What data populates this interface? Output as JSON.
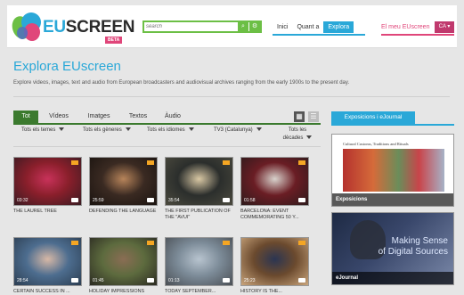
{
  "header": {
    "logo_text_a": "EU",
    "logo_text_b": "SCREEN",
    "logo_badge": "BETA",
    "search_placeholder": "search",
    "nav": [
      "Inici",
      "Quant a",
      "Explora"
    ],
    "my_label": "El meu EUscreen",
    "lang": "CA ▾"
  },
  "page": {
    "title": "Explora EUscreen",
    "intro": "Explore videos, images, text and audio from European broadcasters and audiovisual archives ranging from the early 1900s to the present day."
  },
  "tabs": [
    "Tot",
    "Vídeos",
    "Imatges",
    "Textos",
    "Àudio"
  ],
  "filters": [
    "Tots els temes",
    "Tots els gèneres",
    "Tots els idiomes",
    "TV3 (Catalunya)",
    "Tots les dècades"
  ],
  "items": [
    {
      "duration": "03:32",
      "title": "THE LAUREL TREE",
      "colors": [
        "#8a1f2b",
        "#c8325a",
        "#3a1b22"
      ]
    },
    {
      "duration": "25:59",
      "title": "DEFENDING THE LANGUAGE",
      "colors": [
        "#3a2a22",
        "#b7845a",
        "#1b1410"
      ]
    },
    {
      "duration": "35:54",
      "title": "THE FIRST PUBLICATION OF THE \"AVUI\"",
      "colors": [
        "#2b2e2c",
        "#d9c8a4",
        "#4b4a3e"
      ]
    },
    {
      "duration": "01:58",
      "title": "BARCELONA: EVENT COMMEMORATING 50 Y...",
      "colors": [
        "#6a1d24",
        "#d8d2cc",
        "#2e1b1c"
      ]
    },
    {
      "duration": "28:54",
      "title": "CERTAIN SUCCESS IN ...",
      "colors": [
        "#4d6d8f",
        "#d7b8a6",
        "#2c3e52"
      ]
    },
    {
      "duration": "01:45",
      "title": "HOLIDAY IMPRESSIONS",
      "colors": [
        "#5d6b3e",
        "#8a6d54",
        "#2b2a22"
      ]
    },
    {
      "duration": "01:13",
      "title": "TODAY SEPTEMBER...",
      "colors": [
        "#7d8c99",
        "#b8c4cf",
        "#4a4f55"
      ]
    },
    {
      "duration": "25:23",
      "title": "HISTORY IS THE...",
      "colors": [
        "#6b4a2e",
        "#2b3552",
        "#c9a57c"
      ]
    }
  ],
  "sidebar": {
    "tab": "Exposicions i eJournal",
    "panel1_label": "Exposicions",
    "panel1_caption": "Cultural Customs, Traditions and Rituals",
    "panel2_label": "eJournal",
    "panel2_text_1": "Making Sense",
    "panel2_text_2": "of Digital Sources"
  },
  "colors": {
    "accent_blue": "#2aa8d8",
    "accent_green": "#6cbf45",
    "accent_pink": "#e0467a",
    "tab_green": "#3b7a2e"
  }
}
